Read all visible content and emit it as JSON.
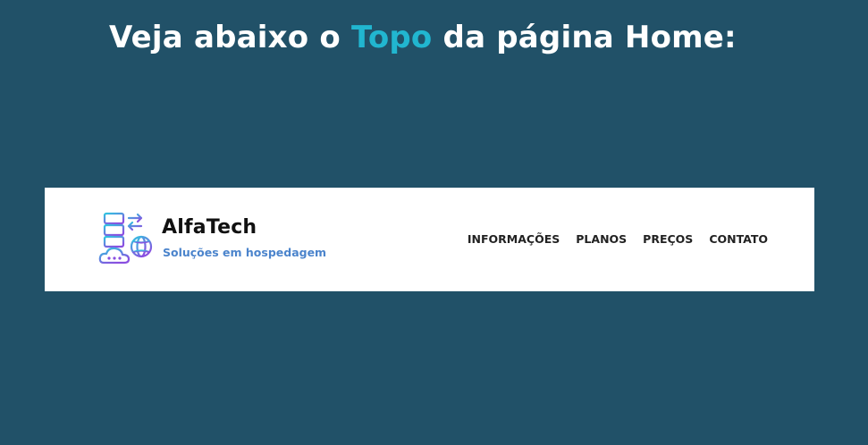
{
  "headline": {
    "before": "Veja abaixo o ",
    "accent": "Topo",
    "after": " da página Home:"
  },
  "colors": {
    "background": "#215168",
    "accent": "#21b6d0",
    "tagline": "#4b84cc"
  },
  "site_header": {
    "logo_icon": "server-cloud-globe-icon",
    "brand_name": "AlfaTech",
    "tagline": "Soluções em hospedagem",
    "nav": [
      {
        "label": "INFORMAÇÕES"
      },
      {
        "label": "PLANOS"
      },
      {
        "label": "PREÇOS"
      },
      {
        "label": "CONTATO"
      }
    ]
  }
}
